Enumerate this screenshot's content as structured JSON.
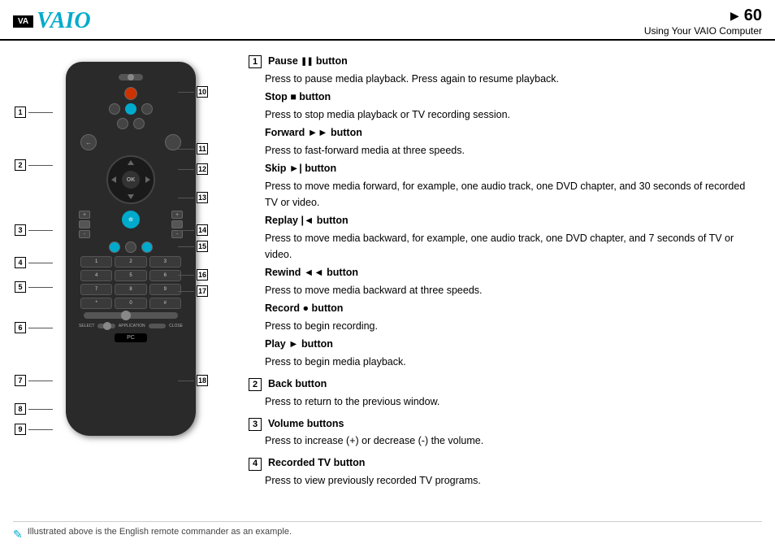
{
  "header": {
    "logo": "VAIO",
    "page_number": "60",
    "page_title": "Using Your VAIO Computer",
    "arrow": "▶"
  },
  "remote": {
    "labels_left": [
      "1",
      "2",
      "3",
      "4",
      "5",
      "6",
      "7",
      "8",
      "9"
    ],
    "labels_right": [
      "10",
      "11",
      "12",
      "13",
      "14",
      "15",
      "16",
      "17",
      "18"
    ],
    "pc_label": "PC"
  },
  "descriptions": [
    {
      "number": "1",
      "items": [
        {
          "title": "Pause ❚❚ button",
          "body": "Press to pause media playback. Press again to resume playback."
        },
        {
          "title": "Stop ■ button",
          "body": "Press to stop media playback or TV recording session."
        },
        {
          "title": "Forward ►► button",
          "body": "Press to fast-forward media at three speeds."
        },
        {
          "title": "Skip ►| button",
          "body": "Press to move media forward, for example, one audio track, one DVD chapter, and 30 seconds of recorded TV or video."
        },
        {
          "title": "Replay |◄ button",
          "body": "Press to move media backward, for example, one audio track, one DVD chapter, and 7 seconds of TV or video."
        },
        {
          "title": "Rewind ◄◄ button",
          "body": "Press to move media backward at three speeds."
        },
        {
          "title": "Record ● button",
          "body": "Press to begin recording."
        },
        {
          "title": "Play ► button",
          "body": "Press to begin media playback."
        }
      ]
    },
    {
      "number": "2",
      "items": [
        {
          "title": "Back button",
          "body": "Press to return to the previous window."
        }
      ]
    },
    {
      "number": "3",
      "items": [
        {
          "title": "Volume buttons",
          "body": "Press to increase (+) or decrease (-) the volume."
        }
      ]
    },
    {
      "number": "4",
      "items": [
        {
          "title": "Recorded TV button",
          "body": "Press to view previously recorded TV programs."
        }
      ]
    }
  ],
  "footer": {
    "icon": "✎",
    "text": "Illustrated above is the English remote commander as an example."
  }
}
